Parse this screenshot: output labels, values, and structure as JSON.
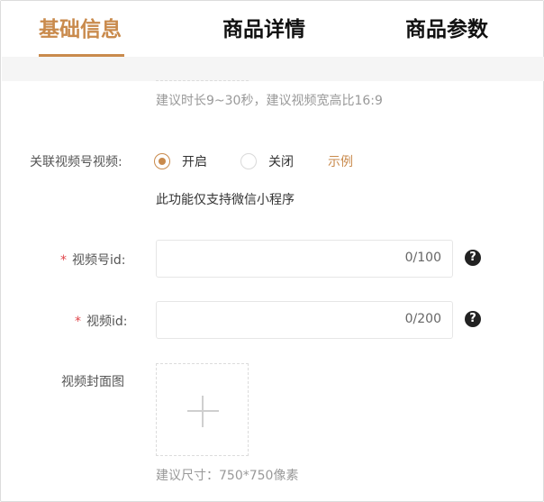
{
  "tabs": [
    {
      "label": "基础信息",
      "active": true
    },
    {
      "label": "商品详情",
      "active": false
    },
    {
      "label": "商品参数",
      "active": false
    }
  ],
  "video_hint": "建议时长9~30秒，建议视频宽高比16:9",
  "link_video": {
    "label": "关联视频号视频:",
    "options": [
      {
        "label": "开启",
        "checked": true
      },
      {
        "label": "关闭",
        "checked": false
      }
    ],
    "example_link": "示例",
    "note": "此功能仅支持微信小程序"
  },
  "channel_id": {
    "required_mark": "*",
    "label": "视频号id:",
    "value": "",
    "counter": "0/100",
    "help_icon": "question-circle-icon"
  },
  "video_id": {
    "required_mark": "*",
    "label": "视频id:",
    "value": "",
    "counter": "0/200",
    "help_icon": "question-circle-icon"
  },
  "cover": {
    "label": "视频封面图",
    "upload_icon": "plus-icon",
    "size_hint": "建议尺寸：750*750像素"
  },
  "colors": {
    "accent": "#c98a4c",
    "required": "#e0454a",
    "muted_text": "#999999"
  }
}
